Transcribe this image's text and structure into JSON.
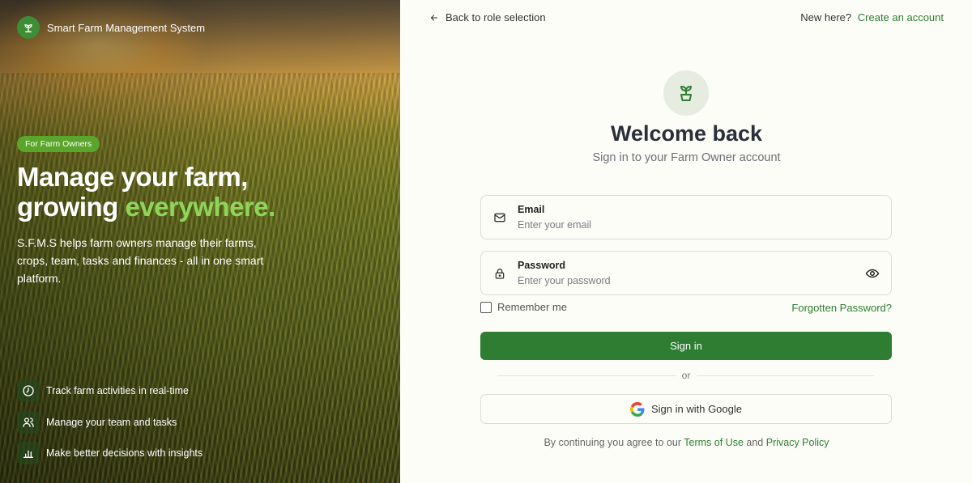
{
  "brand": {
    "name": "Smart Farm Management System"
  },
  "hero": {
    "badge": "For Farm Owners",
    "headline_line1": "Manage your farm,",
    "headline_line2_plain": "growing ",
    "headline_line2_accent": "everywhere.",
    "description": "S.F.M.S helps farm owners manage their farms, crops, team, tasks and finances - all in one smart platform.",
    "features": [
      {
        "icon": "clock-icon",
        "label": "Track farm activities in real-time"
      },
      {
        "icon": "users-icon",
        "label": "Manage your team and tasks"
      },
      {
        "icon": "bar-chart-icon",
        "label": "Make better decisions with insights"
      }
    ]
  },
  "nav": {
    "back_label": "Back to role selection",
    "new_here": "New here?",
    "create_account": "Create an account"
  },
  "form": {
    "title": "Welcome back",
    "subtitle": "Sign in to your Farm Owner account",
    "email": {
      "label": "Email",
      "placeholder": "Enter your email",
      "value": ""
    },
    "password": {
      "label": "Password",
      "placeholder": "Enter your password",
      "value": ""
    },
    "remember_label": "Remember me",
    "remember_checked": false,
    "forgot_label": "Forgotten Password?",
    "signin_label": "Sign in",
    "or_label": "or",
    "google_label": "Sign in with Google",
    "terms_prefix": "By continuing you agree to our ",
    "terms_link": "Terms of Use",
    "terms_and": " and ",
    "privacy_link": "Privacy Policy"
  },
  "colors": {
    "primary": "#2e7d32",
    "accent_text": "#8ed65a",
    "badge": "#5aa62a",
    "background": "#fdfdf8"
  }
}
